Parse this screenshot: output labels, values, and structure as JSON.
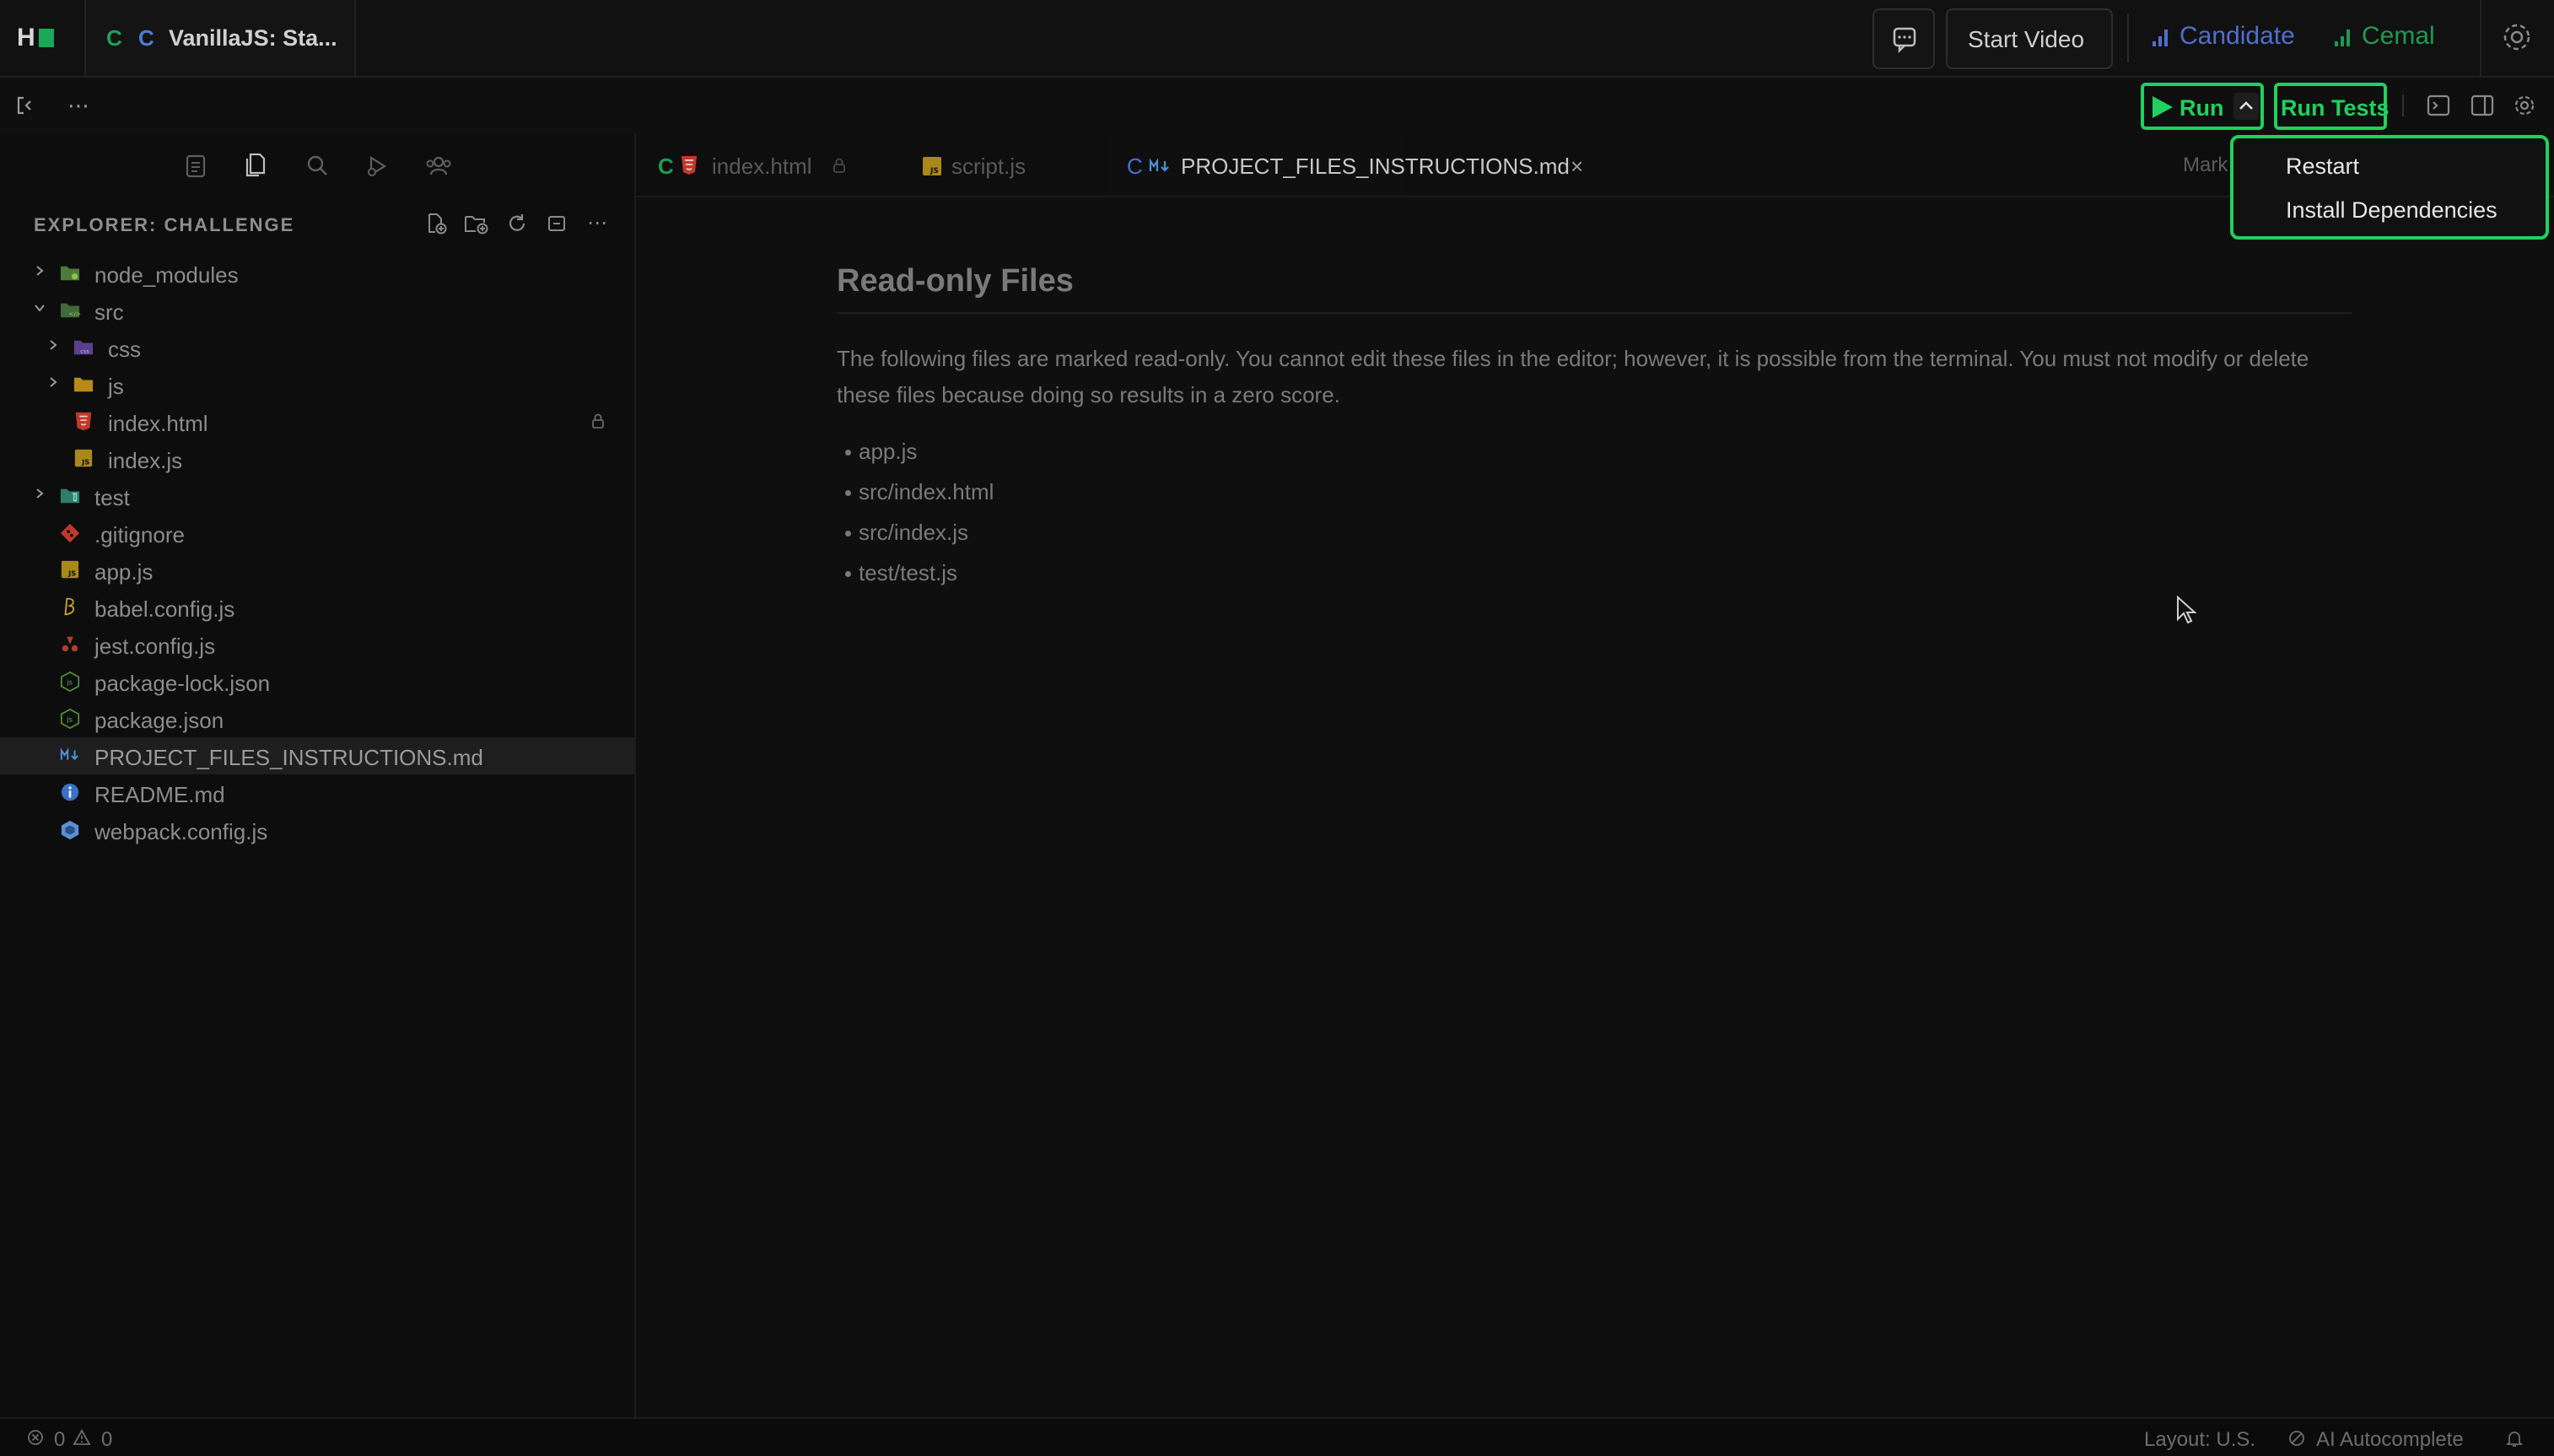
{
  "app": {
    "workspace_title": "VanillaJS: Sta...",
    "workspace_prefix_1": "C",
    "workspace_prefix_2": "C"
  },
  "header": {
    "start_video": "Start Video",
    "candidate_label": "Candidate",
    "interviewer_label": "Cemal",
    "colors": {
      "candidate": "#4f6fcf",
      "interviewer": "#1f9a52"
    }
  },
  "toolbar": {
    "run_label": "Run",
    "run_tests_label": "Run Tests",
    "accent": "#1fd15e"
  },
  "run_menu": {
    "items": [
      "Restart",
      "Install Dependencies"
    ]
  },
  "explorer": {
    "title": "EXPLORER: CHALLENGE",
    "items": [
      {
        "label": "node_modules",
        "icon": "folder-node-icon"
      },
      {
        "label": "src",
        "icon": "folder-src-icon"
      },
      {
        "label": "css",
        "icon": "folder-css-icon"
      },
      {
        "label": "js",
        "icon": "folder-js-icon"
      },
      {
        "label": "index.html",
        "icon": "html-file-icon"
      },
      {
        "label": "index.js",
        "icon": "js-file-icon"
      },
      {
        "label": "test",
        "icon": "folder-test-icon"
      },
      {
        "label": ".gitignore",
        "icon": "git-file-icon"
      },
      {
        "label": "app.js",
        "icon": "js-file-icon"
      },
      {
        "label": "babel.config.js",
        "icon": "babel-file-icon"
      },
      {
        "label": "jest.config.js",
        "icon": "jest-file-icon"
      },
      {
        "label": "package-lock.json",
        "icon": "node-file-icon"
      },
      {
        "label": "package.json",
        "icon": "node-file-icon"
      },
      {
        "label": "PROJECT_FILES_INSTRUCTIONS.md",
        "icon": "markdown-file-icon"
      },
      {
        "label": "README.md",
        "icon": "info-file-icon"
      },
      {
        "label": "webpack.config.js",
        "icon": "webpack-file-icon"
      }
    ]
  },
  "editor": {
    "tabs": [
      {
        "prefix": "C",
        "label": "index.html",
        "icon": "html-file-icon"
      },
      {
        "prefix": "",
        "label": "script.js",
        "icon": "js-file-icon"
      },
      {
        "prefix": "C",
        "label": "PROJECT_FILES_INSTRUCTIONS.md",
        "icon": "markdown-file-icon",
        "active": true
      }
    ],
    "preview_label": "Mark",
    "document": {
      "title": "Read-only Files",
      "paragraph": "The following files are marked read-only. You cannot edit these files in the editor; however, it is possible from the terminal. You must not modify or delete these files because doing so results in a zero score.",
      "list": [
        "app.js",
        "src/index.html",
        "src/index.js",
        "test/test.js"
      ]
    }
  },
  "status": {
    "errors": "0",
    "warnings": "0",
    "layout": "Layout: U.S.",
    "autocomplete": "AI Autocomplete"
  }
}
